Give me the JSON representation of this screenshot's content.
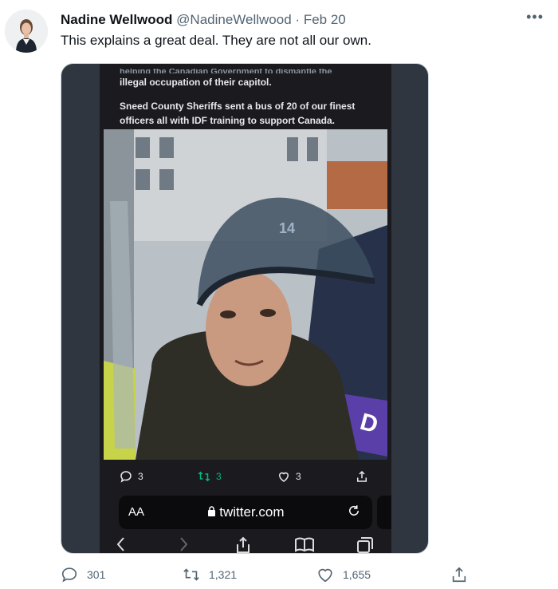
{
  "tweet": {
    "author_name": "Nadine Wellwood",
    "handle": "@NadineWellwood",
    "separator": "·",
    "date": "Feb 20",
    "text": "This explains a great deal. They are not all our own.",
    "more_icon": "more-icon"
  },
  "embedded": {
    "cut_line": "helping the Canadian Government to dismantle the",
    "line_1": "illegal occupation of their capitol.",
    "line_2": "Sneed County Sheriffs sent a bus of 20 of our finest officers all with IDF training to support Canada.",
    "helmet_text": "14",
    "patch_letter": "D",
    "reply_count": "3",
    "retweet_count": "3",
    "like_count": "3",
    "url_aa": "AA",
    "url": "twitter.com"
  },
  "actions": {
    "replies": "301",
    "retweets": "1,321",
    "likes": "1,655"
  },
  "colors": {
    "text_secondary": "#536471",
    "retweet_green": "#00ba7c"
  }
}
